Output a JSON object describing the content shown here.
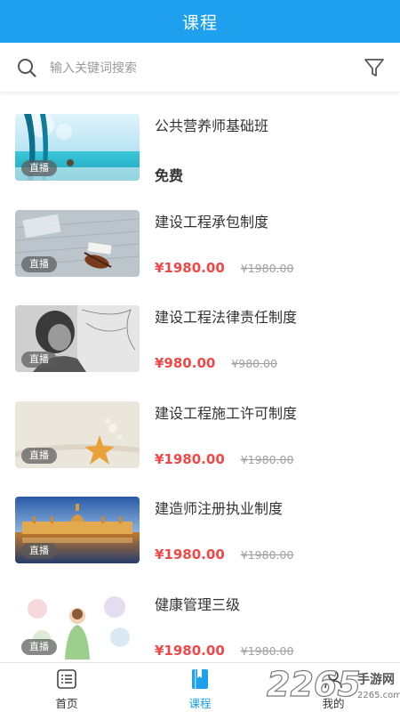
{
  "header": {
    "title": "课程"
  },
  "search": {
    "placeholder": "输入关键词搜索"
  },
  "courses": [
    {
      "title": "公共营养师基础班",
      "price": "免费",
      "badge": "直播"
    },
    {
      "title": "建设工程承包制度",
      "price": "¥1980.00",
      "original_price": "¥1980.00",
      "badge": "直播"
    },
    {
      "title": "建设工程法律责任制度",
      "price": "¥980.00",
      "original_price": "¥980.00",
      "badge": "直播"
    },
    {
      "title": "建设工程施工许可制度",
      "price": "¥1980.00",
      "original_price": "¥1980.00",
      "badge": "直播"
    },
    {
      "title": "建造师注册执业制度",
      "price": "¥1980.00",
      "original_price": "¥1980.00",
      "badge": "直播"
    },
    {
      "title": "健康管理三级",
      "price": "¥1980.00",
      "original_price": "¥1980.00",
      "badge": "直播"
    }
  ],
  "tabs": [
    {
      "label": "首页",
      "icon": "list-icon"
    },
    {
      "label": "课程",
      "icon": "bookmark-book-icon",
      "active": true
    },
    {
      "label": "我的",
      "icon": "user-icon"
    }
  ],
  "watermark": {
    "text": "2265",
    "suffix": "手游网",
    "domain": "2265.com"
  },
  "colors": {
    "primary": "#1ea0ee",
    "price": "#f04848"
  }
}
